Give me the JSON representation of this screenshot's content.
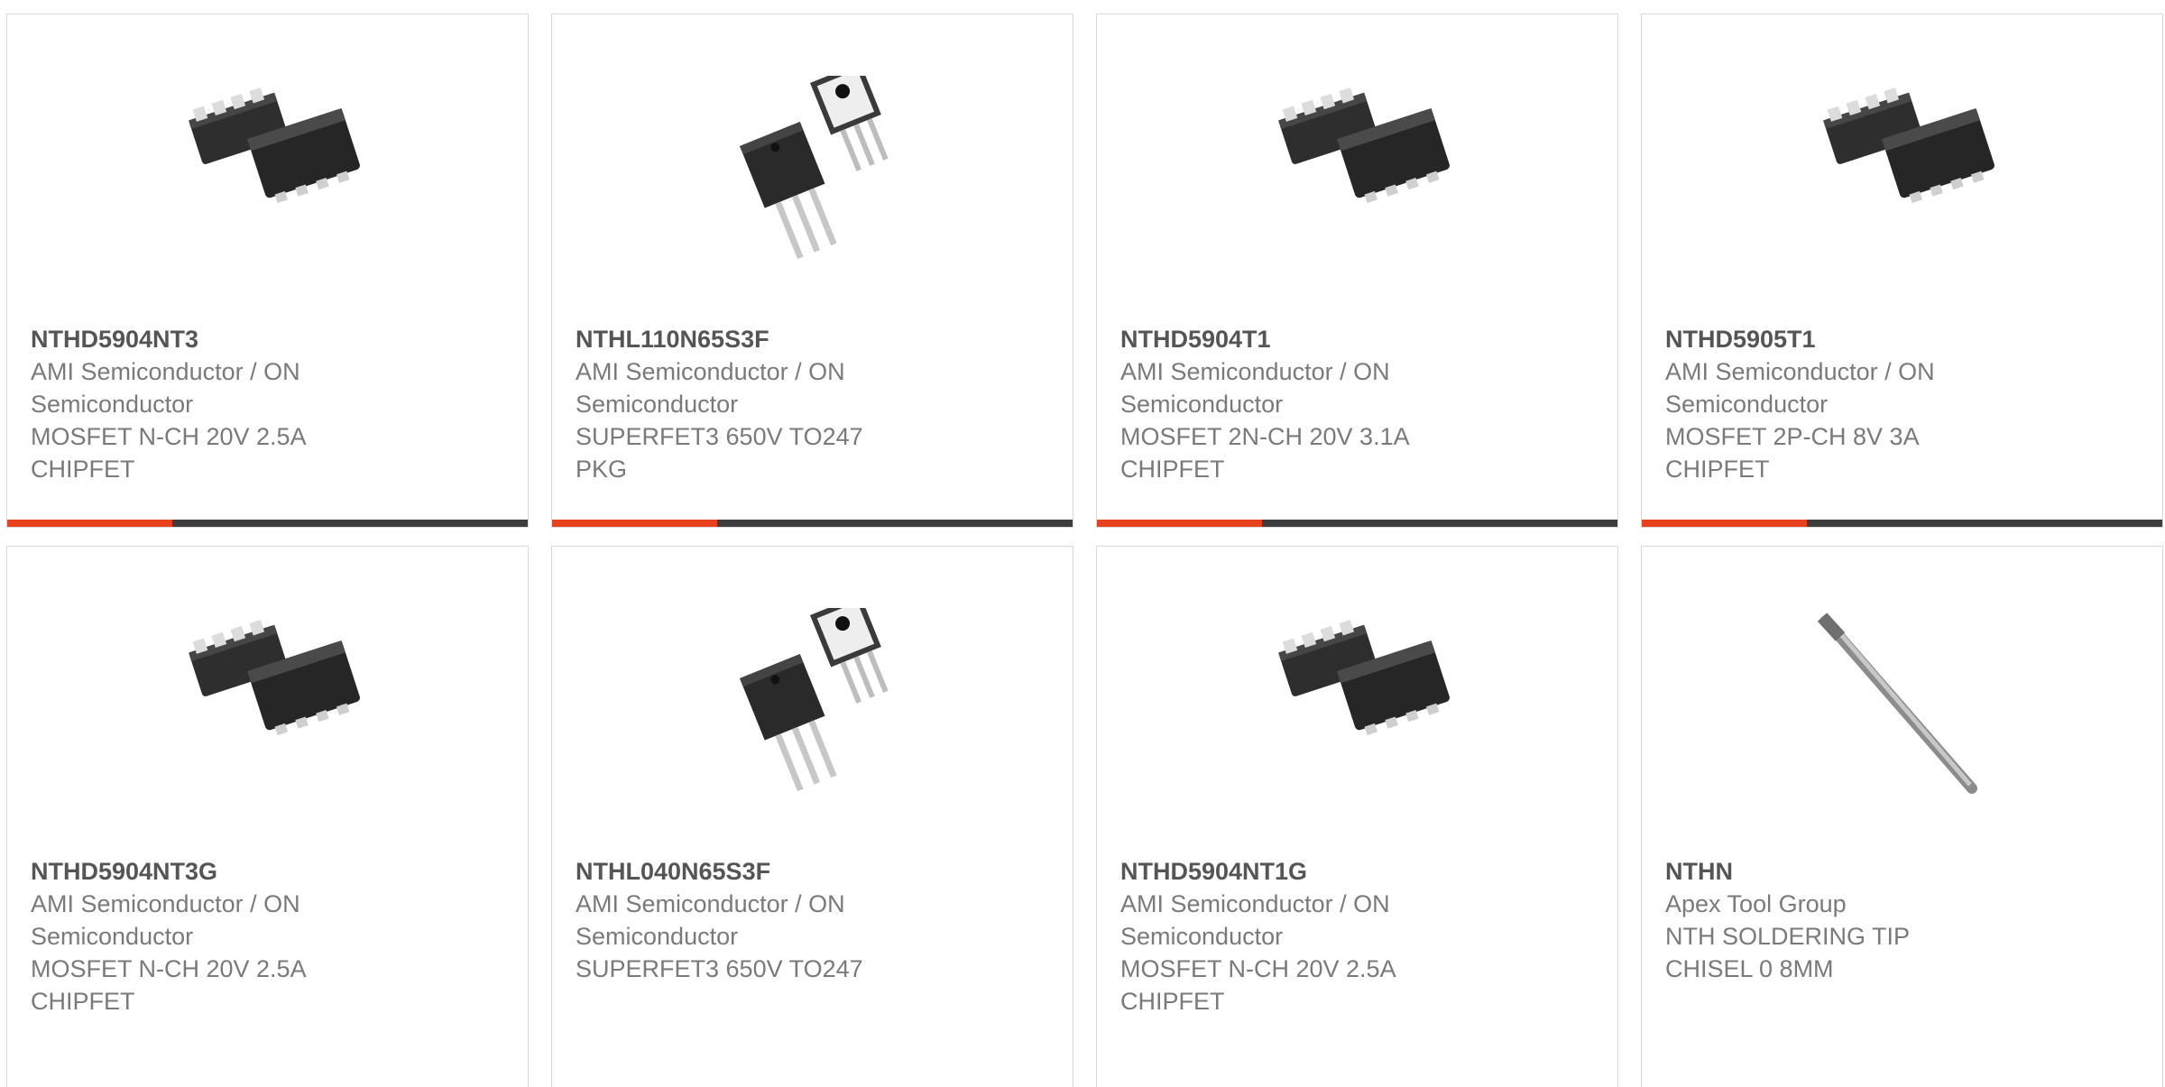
{
  "colors": {
    "accent": "#e8411e",
    "bar": "#3d3d3d"
  },
  "products": [
    {
      "part": "NTHD5904NT3",
      "manufacturer": "AMI Semiconductor / ON Semiconductor",
      "description": "MOSFET N-CH 20V 2.5A CHIPFET",
      "image": "chipfet-package-icon"
    },
    {
      "part": "NTHL110N65S3F",
      "manufacturer": "AMI Semiconductor / ON Semiconductor",
      "description": "SUPERFET3 650V TO247 PKG",
      "image": "to247-package-icon"
    },
    {
      "part": "NTHD5904T1",
      "manufacturer": "AMI Semiconductor / ON Semiconductor",
      "description": "MOSFET 2N-CH 20V 3.1A CHIPFET",
      "image": "chipfet-package-icon"
    },
    {
      "part": "NTHD5905T1",
      "manufacturer": "AMI Semiconductor / ON Semiconductor",
      "description": "MOSFET 2P-CH 8V 3A CHIPFET",
      "image": "chipfet-package-icon"
    },
    {
      "part": "NTHD5904NT3G",
      "manufacturer": "AMI Semiconductor / ON Semiconductor",
      "description": "MOSFET N-CH 20V 2.5A CHIPFET",
      "image": "chipfet-package-icon"
    },
    {
      "part": "NTHL040N65S3F",
      "manufacturer": "AMI Semiconductor / ON Semiconductor",
      "description": "SUPERFET3 650V TO247",
      "image": "to247-package-icon"
    },
    {
      "part": "NTHD5904NT1G",
      "manufacturer": "AMI Semiconductor / ON Semiconductor",
      "description": "MOSFET N-CH 20V 2.5A CHIPFET",
      "image": "chipfet-package-icon"
    },
    {
      "part": "NTHN",
      "manufacturer": "Apex Tool Group",
      "description": "NTH SOLDERING TIP CHISEL 0 8MM",
      "image": "soldering-tip-icon"
    }
  ]
}
